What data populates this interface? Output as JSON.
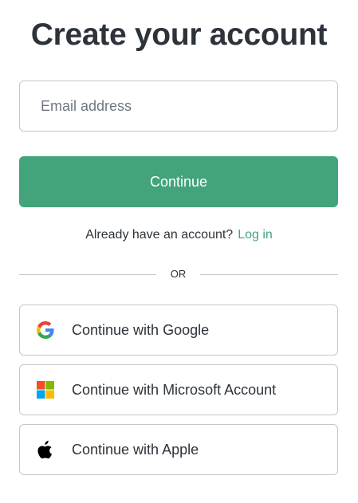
{
  "header": {
    "title": "Create your account"
  },
  "form": {
    "email_placeholder": "Email address",
    "email_value": "",
    "continue_label": "Continue"
  },
  "login_prompt": {
    "text": "Already have an account?",
    "link_label": "Log in"
  },
  "divider": {
    "label": "OR"
  },
  "social": [
    {
      "label": "Continue with Google",
      "icon": "google-icon"
    },
    {
      "label": "Continue with Microsoft Account",
      "icon": "microsoft-icon"
    },
    {
      "label": "Continue with Apple",
      "icon": "apple-icon"
    }
  ],
  "colors": {
    "accent": "#43a47b",
    "text": "#2d333a",
    "border": "#c2c8d0"
  }
}
